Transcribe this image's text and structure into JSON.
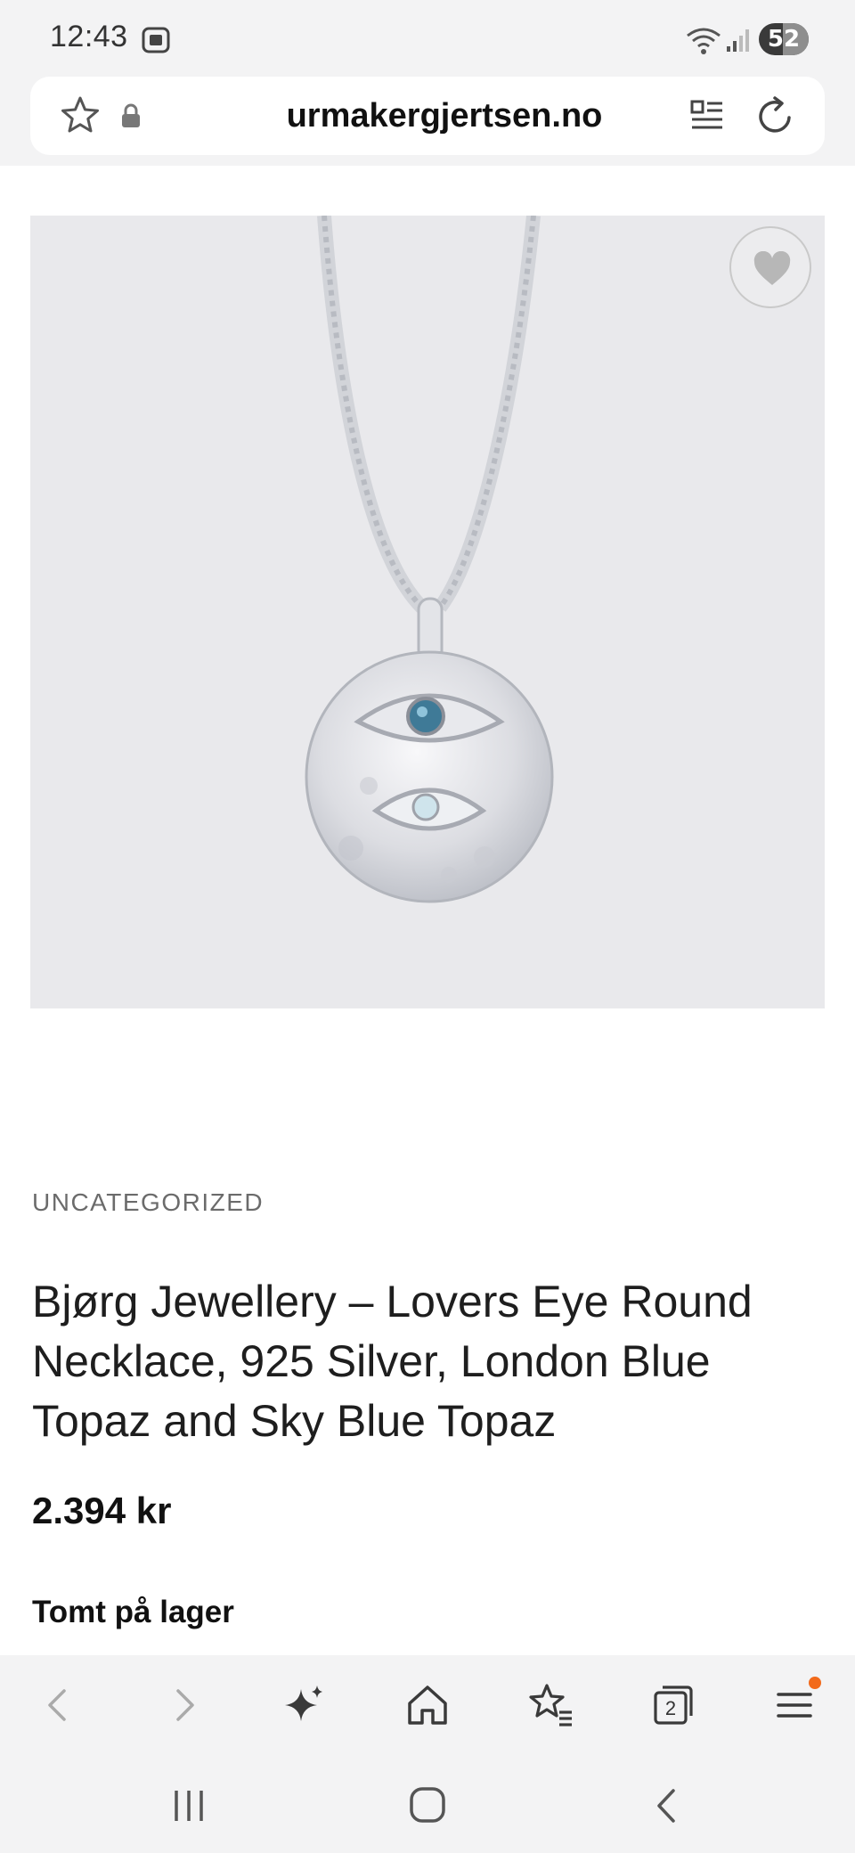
{
  "status_bar": {
    "time": "12:43",
    "battery_level": "52",
    "battery_fraction": 0.52
  },
  "browser": {
    "url": "urmakergjertsen.no",
    "tab_count": "2"
  },
  "product": {
    "category": "UNCATEGORIZED",
    "title": "Bjørg Jewellery – Lovers Eye Round Necklace, 925 Silver, London Blue Topaz and Sky Blue Topaz",
    "price": "2.394 kr",
    "stock_status": "Tomt på lager"
  },
  "icons": {
    "status": [
      "cast-icon",
      "wifi-icon",
      "signal-icon",
      "battery-icon"
    ],
    "urlbar": [
      "star-icon",
      "lock-icon",
      "reader-mode-icon",
      "reload-icon"
    ],
    "toolbar": [
      "back-icon",
      "forward-icon",
      "sparkle-icon",
      "home-icon",
      "bookmarks-icon",
      "tabs-icon",
      "menu-icon"
    ],
    "navbar": [
      "recents-icon",
      "home-icon",
      "back-icon"
    ]
  },
  "colors": {
    "menu_badge": "#f26a1b",
    "chrome_bg": "#f3f3f4",
    "image_bg": "#e9e9ec"
  }
}
